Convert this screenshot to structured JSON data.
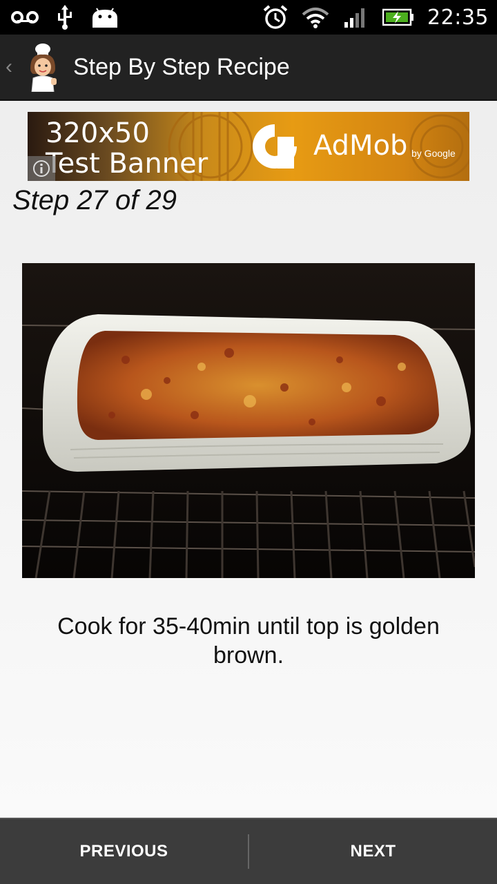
{
  "status_bar": {
    "time": "22:35",
    "icons": [
      "voicemail-icon",
      "usb-icon",
      "android-icon",
      "alarm-icon",
      "wifi-icon",
      "signal-icon",
      "battery-charging-icon"
    ]
  },
  "action_bar": {
    "title": "Step By Step Recipe",
    "logo_icon": "chef-logo-icon"
  },
  "ad_banner": {
    "size_text": "320x50",
    "banner_text": "Test Banner",
    "brand": "AdMob",
    "by_text": "by Google",
    "info_icon": "info-icon"
  },
  "step": {
    "heading": "Step 27 of 29",
    "image_desc": "casserole-in-oven",
    "text": "Cook for 35-40min until top is golden brown."
  },
  "navigation": {
    "previous_label": "PREVIOUS",
    "next_label": "NEXT"
  },
  "colors": {
    "status_bar": "#000000",
    "action_bar": "#222222",
    "bottom_bar": "#3c3c3c",
    "ad_orange": "#e79b13"
  }
}
